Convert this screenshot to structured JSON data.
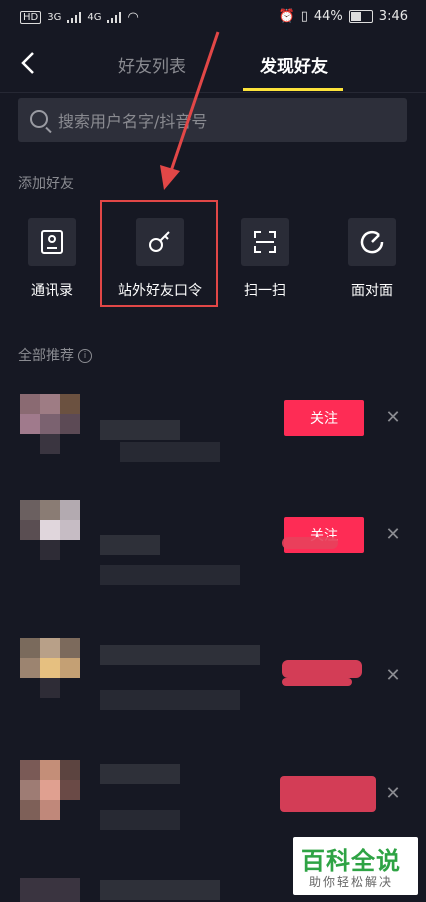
{
  "status_bar": {
    "carrier_tags": "HD",
    "network_1": "3G",
    "network_2": "4G",
    "battery_percent": "44%",
    "time": "3:46"
  },
  "nav": {
    "back_icon": "chevron-left-icon",
    "tab_friends": "好友列表",
    "tab_discover": "发现好友",
    "active_tab": "发现好友",
    "accent": "#fde33b"
  },
  "search": {
    "placeholder": "搜索用户名字/抖音号"
  },
  "add_friends": {
    "title": "添加好友",
    "options": [
      {
        "label": "通讯录",
        "icon": "contacts-icon"
      },
      {
        "label": "站外好友口令",
        "icon": "key-icon"
      },
      {
        "label": "扫一扫",
        "icon": "scan-icon"
      },
      {
        "label": "面对面",
        "icon": "face-to-face-icon"
      }
    ]
  },
  "recommendations": {
    "title": "全部推荐",
    "follow_label": "关注",
    "follow_color": "#fe2c55"
  },
  "watermark": {
    "line1": "百科全说",
    "line2": "助你轻松解决"
  }
}
